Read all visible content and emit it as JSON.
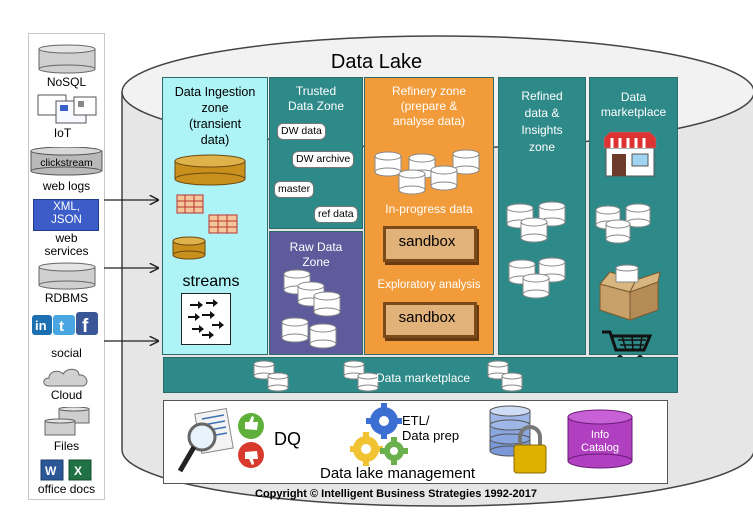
{
  "title": "Data Lake",
  "sources": [
    {
      "label": "NoSQL",
      "icon": "database-icon"
    },
    {
      "label": "IoT",
      "icon": "iot-dashboard-icon"
    },
    {
      "label": "clickstream",
      "icon": "clickstream-cylinder-icon"
    },
    {
      "label": "web logs",
      "icon": ""
    },
    {
      "label": "XML,\nJSON",
      "icon": "xml-json-icon"
    },
    {
      "label": "web\nservices",
      "icon": ""
    },
    {
      "label": "RDBMS",
      "icon": "database-icon"
    },
    {
      "label": "social",
      "icon": "social-logos-icon"
    },
    {
      "label": "Cloud",
      "icon": "cloud-icon"
    },
    {
      "label": "Files",
      "icon": "files-icon"
    },
    {
      "label": "office docs",
      "icon": "office-docs-icon"
    }
  ],
  "zones": {
    "ingestion": {
      "title": "Data Ingestion\nzone\n(transient\ndata)",
      "streams": "streams"
    },
    "trusted": {
      "title": "Trusted\nData Zone",
      "tags": [
        "DW data",
        "DW archive",
        "master",
        "ref data"
      ]
    },
    "raw": {
      "title": "Raw Data\nZone"
    },
    "refinery": {
      "title": "Refinery zone\n(prepare &\nanalyse data)",
      "in_progress": "In-progress data",
      "sandbox1": "sandbox",
      "exploratory": "Exploratory analysis",
      "sandbox2": "sandbox"
    },
    "refined": {
      "title": "Refined\ndata &\nInsights\nzone"
    },
    "marketplace": {
      "title": "Data\nmarketplace"
    }
  },
  "marketplace_bar": {
    "label": "Data marketplace"
  },
  "management": {
    "title": "Data lake management",
    "dq": "DQ",
    "etl": "ETL/\nData prep",
    "info_catalog": "Info\nCatalog"
  },
  "copyright": "Copyright © Intelligent Business Strategies 1992-2017",
  "colors": {
    "teal": "#2e8a89",
    "ingestion": "#aef3f6",
    "raw": "#5d5b9b",
    "refinery": "#f29b3a",
    "catalog": "#b040c0",
    "drum": "#cfcfcf"
  }
}
